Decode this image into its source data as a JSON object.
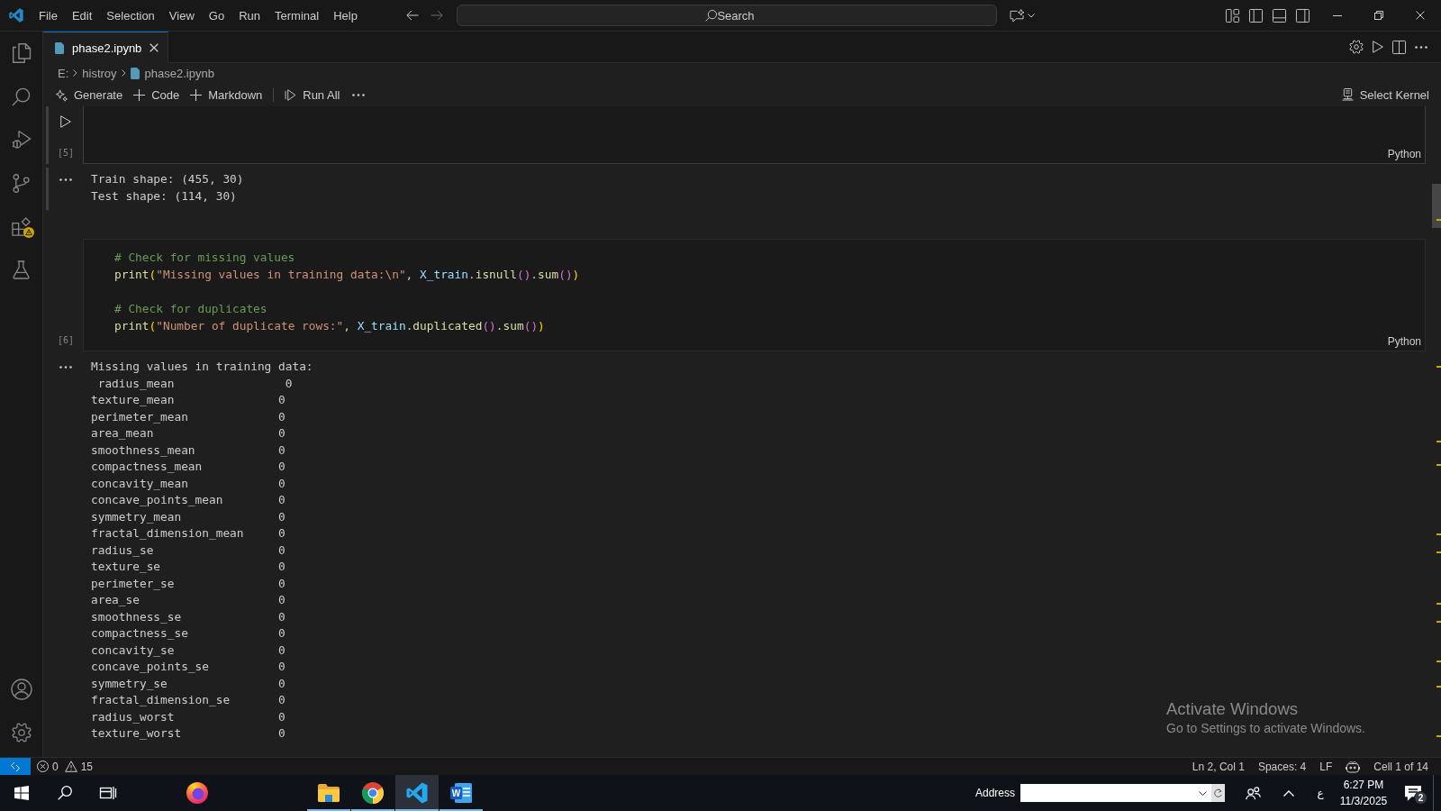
{
  "title_bar": {
    "menu": [
      "File",
      "Edit",
      "Selection",
      "View",
      "Go",
      "Run",
      "Terminal",
      "Help"
    ],
    "navigation": [
      {
        "kind": "back",
        "disabled": false
      },
      {
        "kind": "forward",
        "disabled": true
      }
    ],
    "search": {
      "placeholder": "Search"
    }
  },
  "activity_bar": {
    "top": [
      {
        "kind": "explorer",
        "selected": false,
        "warning": false
      },
      {
        "kind": "search",
        "selected": false,
        "warning": false
      },
      {
        "kind": "debug",
        "selected": false,
        "warning": false
      },
      {
        "kind": "scm",
        "selected": false,
        "warning": false
      },
      {
        "kind": "extensions",
        "selected": false,
        "warning": true
      },
      {
        "kind": "testing",
        "selected": false,
        "warning": false
      }
    ],
    "bottom": [
      {
        "kind": "accounts"
      },
      {
        "kind": "settings"
      }
    ]
  },
  "tabs": [
    {
      "label": "phase2.ipynb",
      "selected": true
    }
  ],
  "breadcrumb": [
    {
      "kind": "folder",
      "label": "E:"
    },
    {
      "kind": "folder",
      "label": "histroy"
    },
    {
      "kind": "notebook",
      "label": "phase2.ipynb"
    }
  ],
  "notebook_toolbar": {
    "actions": [
      {
        "kind": "generate",
        "label": "Generate"
      },
      {
        "kind": "add",
        "label": "Code"
      },
      {
        "kind": "add",
        "label": "Markdown"
      },
      {
        "kind": "run_all",
        "label": "Run All"
      }
    ],
    "kernel": {
      "label": "Select Kernel"
    }
  },
  "cells": [
    {
      "execution_count": "[5]",
      "language": "Python",
      "focused": true,
      "output": [
        "Train shape: (455, 30)",
        "Test shape: (114, 30)"
      ]
    },
    {
      "execution_count": "[6]",
      "language": "Python",
      "focused": false,
      "code": [
        {
          "kind": "code",
          "tokens": [
            {
              "kind": "comment",
              "text": "# Check for missing values"
            }
          ]
        },
        {
          "kind": "code",
          "tokens": [
            {
              "kind": "function",
              "text": "print"
            },
            {
              "kind": "bracket",
              "text": "("
            },
            {
              "kind": "string",
              "text": "\"Missing values in training data:\\n\""
            },
            {
              "kind": "plain",
              "text": ", "
            },
            {
              "kind": "variable",
              "text": "X_train"
            },
            {
              "kind": "plain",
              "text": "."
            },
            {
              "kind": "function",
              "text": "isnull"
            },
            {
              "kind": "bracket2",
              "text": "()"
            },
            {
              "kind": "plain",
              "text": "."
            },
            {
              "kind": "function",
              "text": "sum"
            },
            {
              "kind": "bracket2",
              "text": "()"
            },
            {
              "kind": "bracket",
              "text": ")"
            }
          ]
        },
        {
          "kind": "blank"
        },
        {
          "kind": "code",
          "tokens": [
            {
              "kind": "comment",
              "text": "# Check for duplicates"
            }
          ]
        },
        {
          "kind": "code",
          "tokens": [
            {
              "kind": "function",
              "text": "print"
            },
            {
              "kind": "bracket",
              "text": "("
            },
            {
              "kind": "string",
              "text": "\"Number of duplicate rows:\""
            },
            {
              "kind": "plain",
              "text": ", "
            },
            {
              "kind": "variable",
              "text": "X_train"
            },
            {
              "kind": "plain",
              "text": "."
            },
            {
              "kind": "function",
              "text": "duplicated"
            },
            {
              "kind": "bracket2",
              "text": "()"
            },
            {
              "kind": "plain",
              "text": "."
            },
            {
              "kind": "function",
              "text": "sum"
            },
            {
              "kind": "bracket2",
              "text": "()"
            },
            {
              "kind": "bracket",
              "text": ")"
            }
          ]
        }
      ],
      "output": [
        "Missing values in training data:",
        " radius_mean                0",
        "texture_mean               0",
        "perimeter_mean             0",
        "area_mean                  0",
        "smoothness_mean            0",
        "compactness_mean           0",
        "concavity_mean             0",
        "concave_points_mean        0",
        "symmetry_mean              0",
        "fractal_dimension_mean     0",
        "radius_se                  0",
        "texture_se                 0",
        "perimeter_se               0",
        "area_se                    0",
        "smoothness_se              0",
        "compactness_se             0",
        "concavity_se               0",
        "concave_points_se          0",
        "symmetry_se                0",
        "fractal_dimension_se       0",
        "radius_worst               0",
        "texture_worst              0"
      ]
    }
  ],
  "status_bar": {
    "errors": "0",
    "warnings": "15",
    "items": [
      {
        "kind": "text",
        "label": "Ln 2, Col 1"
      },
      {
        "kind": "text",
        "label": "Spaces: 4"
      },
      {
        "kind": "text",
        "label": "LF"
      },
      {
        "kind": "copilot"
      },
      {
        "kind": "text",
        "label": "Cell 1 of 14"
      }
    ]
  },
  "taskbar": {
    "quick_launch": [
      {
        "kind": "firefox"
      }
    ],
    "apps": [
      {
        "kind": "explorer",
        "running": true,
        "active": false
      },
      {
        "kind": "chrome",
        "running": true,
        "active": false
      },
      {
        "kind": "vscode",
        "running": true,
        "active": true
      },
      {
        "kind": "word",
        "running": true,
        "active": false,
        "letter": "W"
      }
    ],
    "address": {
      "label": "Address"
    },
    "language": "ع",
    "time": "6:27 PM",
    "date": "11/3/2025",
    "notifications": "2"
  },
  "activation_notice": {
    "title": "Activate Windows",
    "text": "Go to Settings to activate Windows."
  }
}
